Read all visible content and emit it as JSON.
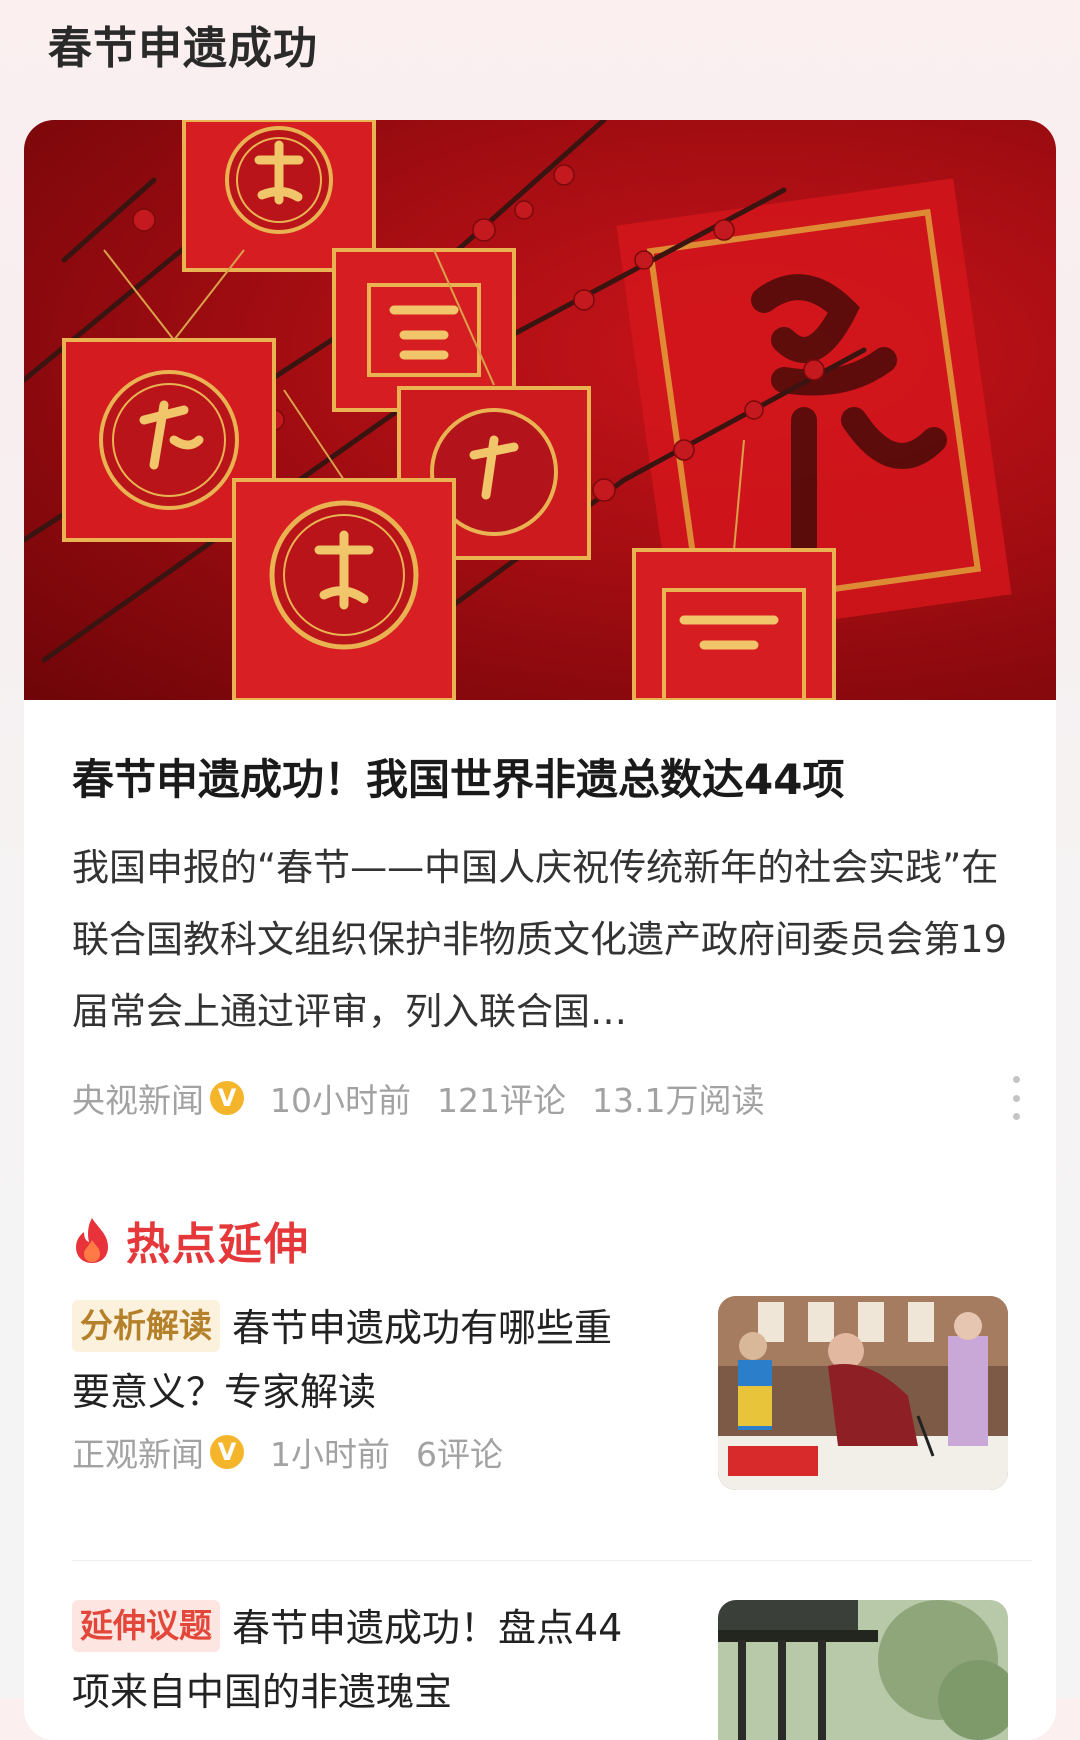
{
  "topic": {
    "title": "春节申遗成功"
  },
  "article": {
    "headline": "春节申遗成功！我国世界非遗总数达44项",
    "summary": "我国申报的“春节——中国人庆祝传统新年的社会实践”在联合国教科文组织保护非物质文化遗产政府间委员会第19届常会上通过评审，列入联合国…",
    "source": "央视新闻",
    "verified_mark": "V",
    "time": "10小时前",
    "comments": "121评论",
    "reads": "13.1万阅读"
  },
  "section": {
    "title": "热点延伸"
  },
  "related": [
    {
      "tag": "分析解读",
      "title": "春节申遗成功有哪些重要意义？专家解读",
      "source": "正观新闻",
      "verified_mark": "V",
      "time": "1小时前",
      "comments": "6评论"
    },
    {
      "tag": "延伸议题",
      "title": "春节申遗成功！盘点44项来自中国的非遗瑰宝"
    }
  ],
  "colors": {
    "accent_red": "#e5383a",
    "tag_analysis_text": "#b5802a",
    "verified_badge": "#f5b52a"
  },
  "icons": [
    "fire-icon",
    "verified-icon",
    "more-vertical-icon"
  ]
}
